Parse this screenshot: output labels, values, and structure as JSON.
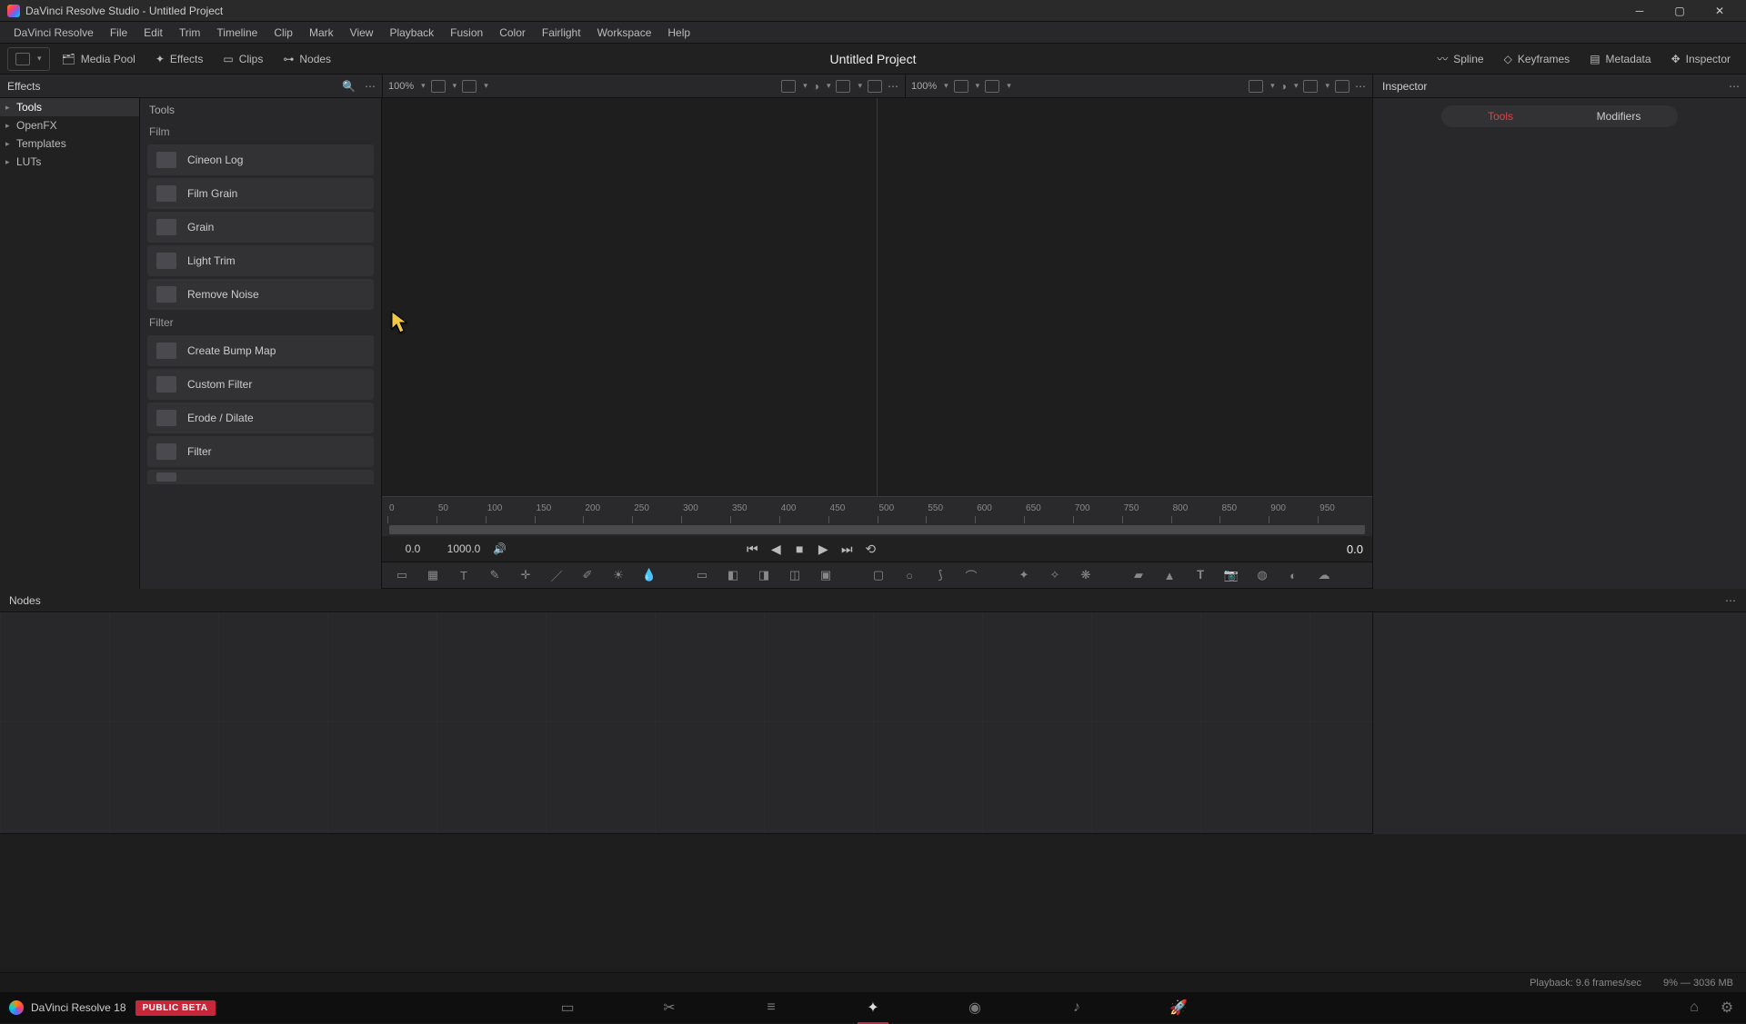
{
  "titlebar": {
    "title": "DaVinci Resolve Studio - Untitled Project"
  },
  "menu": [
    "DaVinci Resolve",
    "File",
    "Edit",
    "Trim",
    "Timeline",
    "Clip",
    "Mark",
    "View",
    "Playback",
    "Fusion",
    "Color",
    "Fairlight",
    "Workspace",
    "Help"
  ],
  "toolbar": {
    "media_pool": "Media Pool",
    "effects": "Effects",
    "clips": "Clips",
    "nodes": "Nodes",
    "project_title": "Untitled Project",
    "spline": "Spline",
    "keyframes": "Keyframes",
    "metadata": "Metadata",
    "inspector": "Inspector"
  },
  "secondary": {
    "effects_label": "Effects",
    "zoom_a": "100%",
    "zoom_b": "100%",
    "inspector_label": "Inspector"
  },
  "fx_tree": {
    "items": [
      {
        "label": "Tools",
        "sel": true,
        "caret": true
      },
      {
        "label": "OpenFX",
        "sel": false,
        "caret": true
      },
      {
        "label": "Templates",
        "sel": false,
        "caret": true
      },
      {
        "label": "LUTs",
        "sel": false,
        "caret": true
      }
    ]
  },
  "fx_list": {
    "header": "Tools",
    "cat1": "Film",
    "film_items": [
      "Cineon Log",
      "Film Grain",
      "Grain",
      "Light Trim",
      "Remove Noise"
    ],
    "cat2": "Filter",
    "filter_items": [
      "Create Bump Map",
      "Custom Filter",
      "Erode / Dilate",
      "Filter"
    ]
  },
  "ruler_ticks": [
    "0",
    "50",
    "100",
    "150",
    "200",
    "250",
    "300",
    "350",
    "400",
    "450",
    "500",
    "550",
    "600",
    "650",
    "700",
    "750",
    "800",
    "850",
    "900",
    "950"
  ],
  "playback": {
    "in": "0.0",
    "out": "1000.0",
    "current": "0.0"
  },
  "inspector_tabs": {
    "tools": "Tools",
    "modifiers": "Modifiers"
  },
  "nodes_label": "Nodes",
  "status": {
    "playback": "Playback: 9.6 frames/sec",
    "mem": "9% — 3036 MB"
  },
  "brand": {
    "name": "DaVinci Resolve 18",
    "badge": "PUBLIC BETA"
  }
}
